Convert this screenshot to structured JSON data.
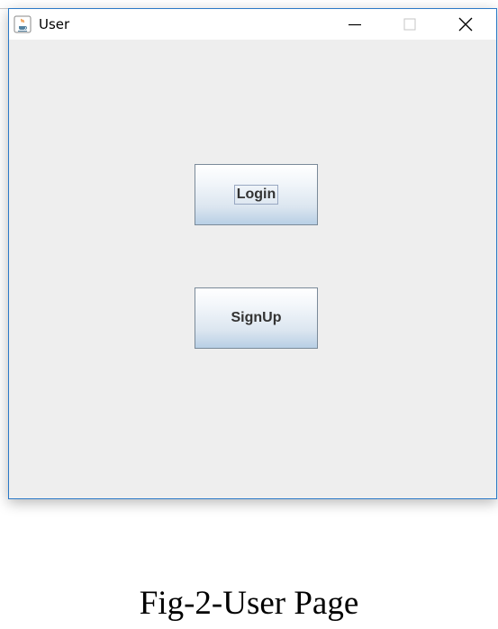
{
  "window": {
    "title": "User",
    "accent_color": "#2b79c7",
    "icon": "java-coffee-cup-icon"
  },
  "buttons": {
    "login_label": "Login",
    "signup_label": "SignUp"
  },
  "caption": "Fig-2-User Page"
}
